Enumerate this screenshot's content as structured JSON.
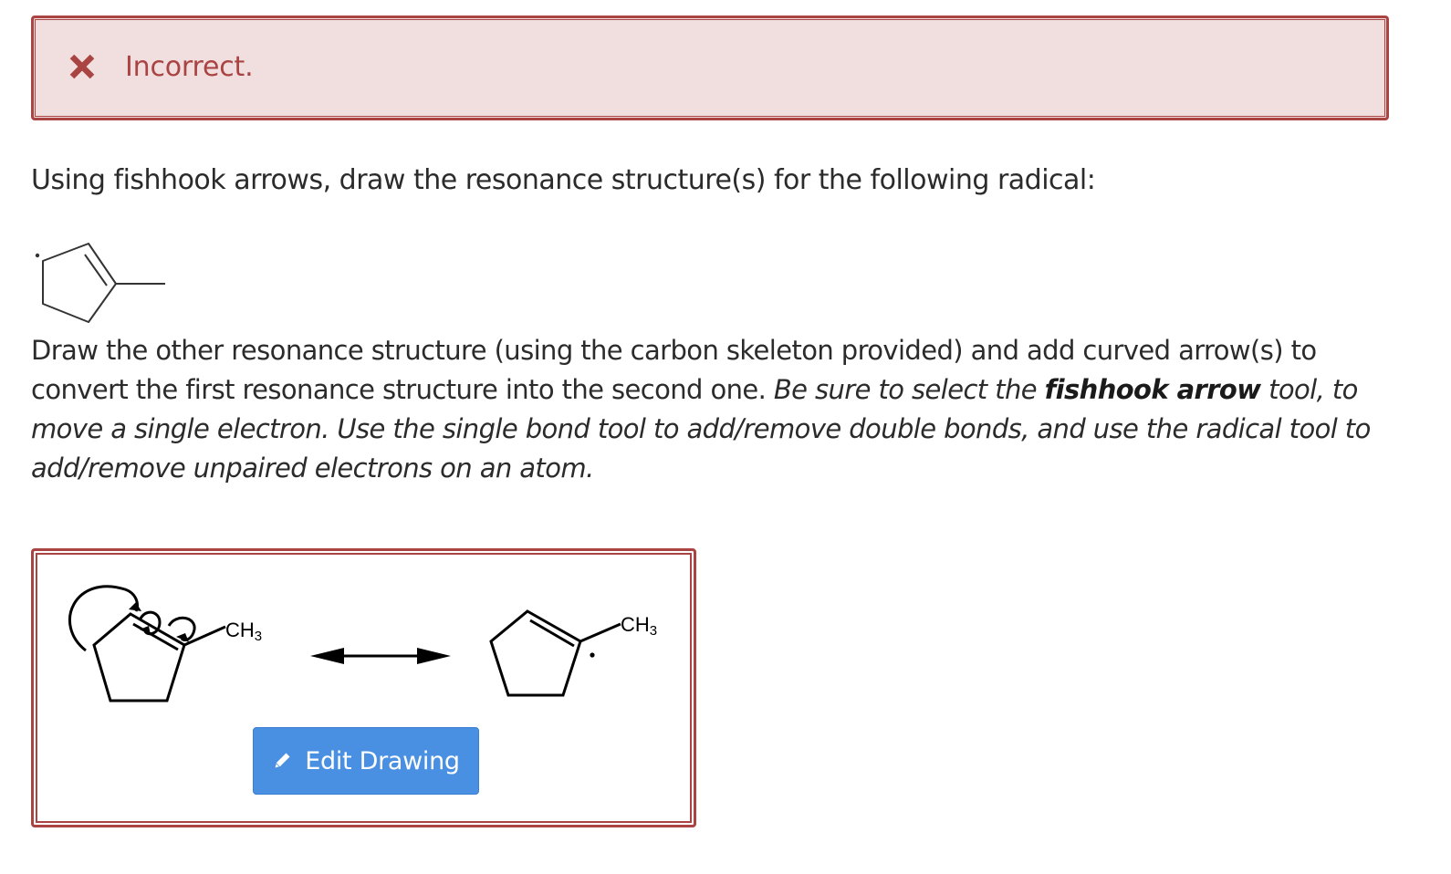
{
  "feedback": {
    "icon": "close-icon",
    "text": "Incorrect.",
    "color": "#a94442",
    "background": "#f1dfe0"
  },
  "question": {
    "text": "Using fishhook arrows, draw the resonance structure(s) for the following radical:"
  },
  "instructions": {
    "plain_part": "Draw the other resonance structure (using the carbon skeleton provided) and add curved arrow(s) to convert the first resonance structure into the second one.",
    "italic_before_bold": "Be sure to select the",
    "italic_bold": "fishhook arrow",
    "italic_after_bold": "tool, to move a single electron. Use the single bond tool to add/remove double bonds, and use the radical tool to add/remove unpaired electrons on an atom."
  },
  "answer": {
    "left_label_main": "CH",
    "left_label_sub": "3",
    "right_label_main": "CH",
    "right_label_sub": "3",
    "edit_button_label": "Edit Drawing",
    "edit_button_icon": "pencil-icon",
    "button_color": "#4a90e2"
  }
}
